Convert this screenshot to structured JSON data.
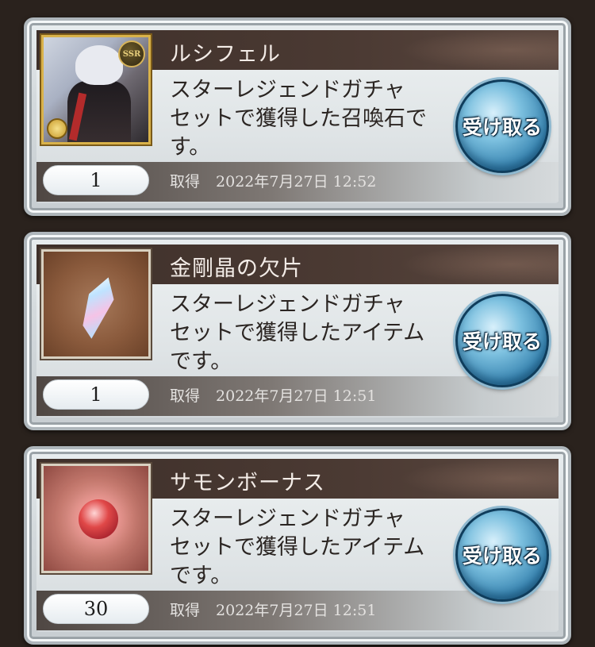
{
  "items": [
    {
      "name": "ルシフェル",
      "description_lines": [
        "スターレジェンドガチャ",
        "セットで獲得した召喚石で",
        "す。"
      ],
      "count": "1",
      "acquired_label": "取得",
      "acquired_time": "2022年7月27日 12:52",
      "button_label": "受け取る",
      "thumbnail_icon": "summon-character-icon",
      "badge": "SSR"
    },
    {
      "name": "金剛晶の欠片",
      "description_lines": [
        "スターレジェンドガチャ",
        "セットで獲得したアイテム",
        "です。"
      ],
      "count": "1",
      "acquired_label": "取得",
      "acquired_time": "2022年7月27日 12:51",
      "button_label": "受け取る",
      "thumbnail_icon": "crystal-fragment-icon"
    },
    {
      "name": "サモンボーナス",
      "description_lines": [
        "スターレジェンドガチャ",
        "セットで獲得したアイテム",
        "です。"
      ],
      "count": "30",
      "acquired_label": "取得",
      "acquired_time": "2022年7月27日 12:51",
      "button_label": "受け取る",
      "thumbnail_icon": "red-orb-icon"
    }
  ],
  "colors": {
    "title_bar": "#3e302a",
    "button_blue": "#3a86b2",
    "background": "#2a221d"
  }
}
